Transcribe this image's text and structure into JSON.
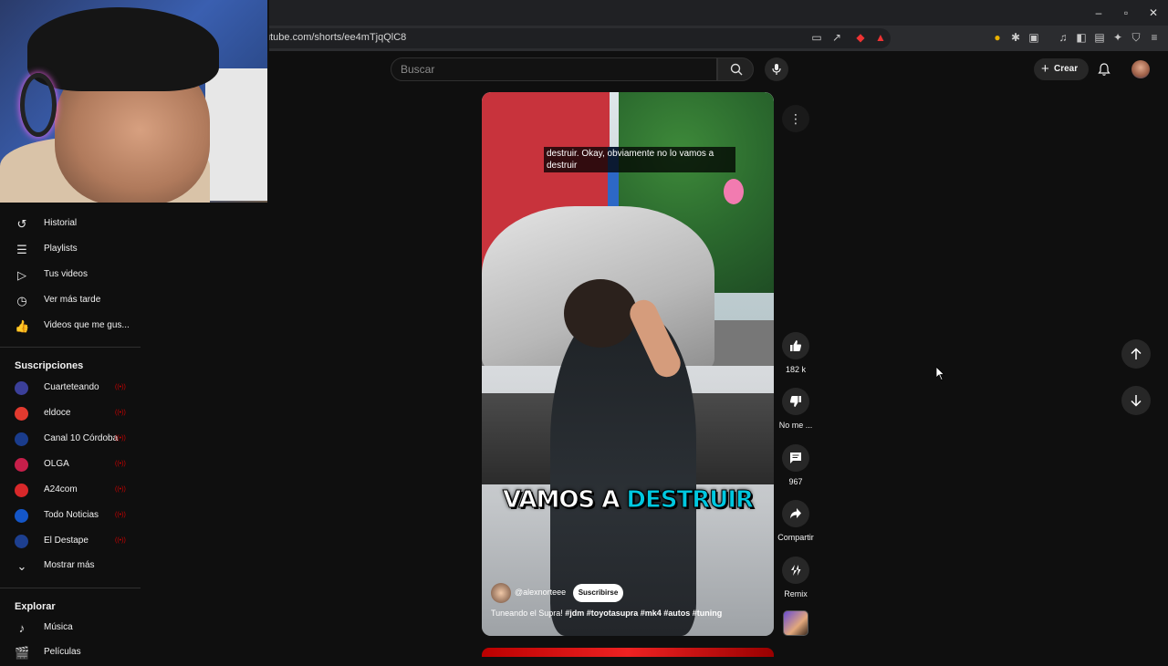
{
  "browser": {
    "url": "utube.com/shorts/ee4mTjqQlC8",
    "window_controls": {
      "minimize": "–",
      "restore": "▫",
      "close": "✕"
    }
  },
  "header": {
    "search_placeholder": "Buscar",
    "create_label": "Crear"
  },
  "sidebar": {
    "you_items": [
      {
        "label": "Historial",
        "icon": "history-icon"
      },
      {
        "label": "Playlists",
        "icon": "playlists-icon"
      },
      {
        "label": "Tus videos",
        "icon": "your-videos-icon"
      },
      {
        "label": "Ver más tarde",
        "icon": "watch-later-icon"
      },
      {
        "label": "Videos que me gus...",
        "icon": "liked-videos-icon"
      }
    ],
    "subscriptions_heading": "Suscripciones",
    "subscriptions": [
      {
        "label": "Cuarteteando",
        "color": "#3b3f99"
      },
      {
        "label": "eldoce",
        "color": "#e23a2f"
      },
      {
        "label": "Canal 10 Córdoba",
        "color": "#1a3c8c"
      },
      {
        "label": "OLGA",
        "color": "#c61f4a"
      },
      {
        "label": "A24com",
        "color": "#d8282a"
      },
      {
        "label": "Todo Noticias",
        "color": "#1456c8"
      },
      {
        "label": "El Destape",
        "color": "#1d3f8f"
      }
    ],
    "show_more_label": "Mostrar más",
    "explore_heading": "Explorar",
    "explore_items": [
      {
        "label": "Música",
        "icon": "music-icon"
      },
      {
        "label": "Películas",
        "icon": "movies-icon"
      }
    ]
  },
  "short": {
    "subtitle_line": "destruir. Okay, obviamente no lo vamos a destruir",
    "caption_word1": "VAMOS A",
    "caption_word2": "DESTRUIR",
    "channel_handle": "@alexnorteee",
    "subscribe_label": "Suscribirse",
    "description_prefix": "Tuneando el Supra!",
    "hashtags": "#jdm #toyotasupra #mk4 #autos #tuning"
  },
  "actions": {
    "like_count": "182 k",
    "dislike_label": "No me ...",
    "comments_count": "967",
    "share_label": "Compartir",
    "remix_label": "Remix"
  }
}
